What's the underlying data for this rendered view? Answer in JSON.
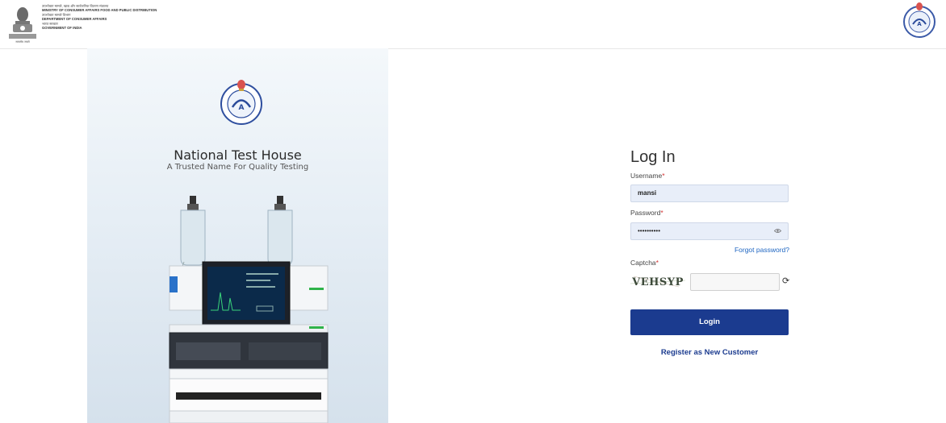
{
  "header": {
    "ministry_hindi": "उपभोक्ता मामले, खाद्य और सार्वजनिक वितरण मंत्रालय",
    "ministry_english": "MINISTRY OF CONSUMER AFFAIRS FOOD AND PUBLIC DISTRIBUTION",
    "department_hindi": "उपभोक्ता मामले विभाग",
    "department_english": "DEPARTMENT OF CONSUMER AFFAIRS",
    "govt_hindi": "भारत सरकार",
    "govt_english": "GOVERNMENT OF INDIA",
    "emblem_caption": "सत्यमेव जयते"
  },
  "hero": {
    "title": "National Test House",
    "tagline": "A Trusted Name For Quality Testing"
  },
  "login": {
    "title": "Log In",
    "username_label": "Username",
    "username_value": "mansi",
    "password_label": "Password",
    "password_value": "••••••••••",
    "forgot_link": "Forgot password?",
    "captcha_label": "Captcha",
    "captcha_text": "VEHSYP",
    "captcha_input_value": "",
    "login_button": "Login",
    "register_link": "Register as New Customer",
    "required_mark": "*"
  },
  "colors": {
    "primary": "#1b3b8f",
    "link": "#1f66c2",
    "input_bg": "#e8eef9",
    "required": "#d32f2f"
  }
}
